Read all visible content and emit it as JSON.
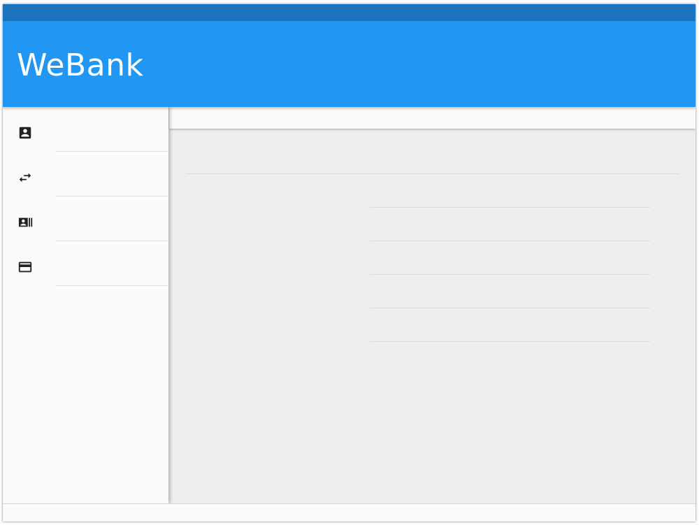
{
  "app": {
    "title": "WeBank",
    "colors": {
      "status_bar": "#1c74bf",
      "app_bar": "#2196f3",
      "drawer": "#fafafa",
      "content": "#eeeeee"
    }
  },
  "nav": {
    "items": [
      {
        "icon": "account-box-icon",
        "label": ""
      },
      {
        "icon": "swap-horiz-icon",
        "label": ""
      },
      {
        "icon": "contacts-list-icon",
        "label": ""
      },
      {
        "icon": "credit-card-icon",
        "label": ""
      }
    ]
  }
}
